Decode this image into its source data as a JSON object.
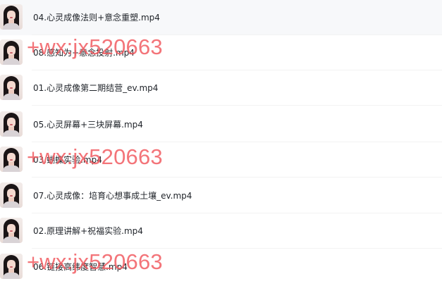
{
  "files": [
    {
      "name": "04.心灵成像法则+意念重塑.mp4",
      "icon": "video-thumbnail-icon"
    },
    {
      "name": "08.感知为+意念投射.mp4",
      "icon": "video-thumbnail-icon"
    },
    {
      "name": "01.心灵成像第二期结营_ev.mp4",
      "icon": "video-thumbnail-icon"
    },
    {
      "name": "05.心灵屏幕+三块屏幕.mp4",
      "icon": "video-thumbnail-icon"
    },
    {
      "name": "03.蝴蝶实验.mp4",
      "icon": "video-thumbnail-icon"
    },
    {
      "name": "07.心灵成像：培育心想事成土壤_ev.mp4",
      "icon": "video-thumbnail-icon"
    },
    {
      "name": "02.原理讲解+祝福实验.mp4",
      "icon": "video-thumbnail-icon"
    },
    {
      "name": "06.链接高纬度智慧.mp4",
      "icon": "video-thumbnail-icon"
    }
  ],
  "watermark": {
    "text": "+wx:jx520663",
    "color": "#f25c62"
  }
}
